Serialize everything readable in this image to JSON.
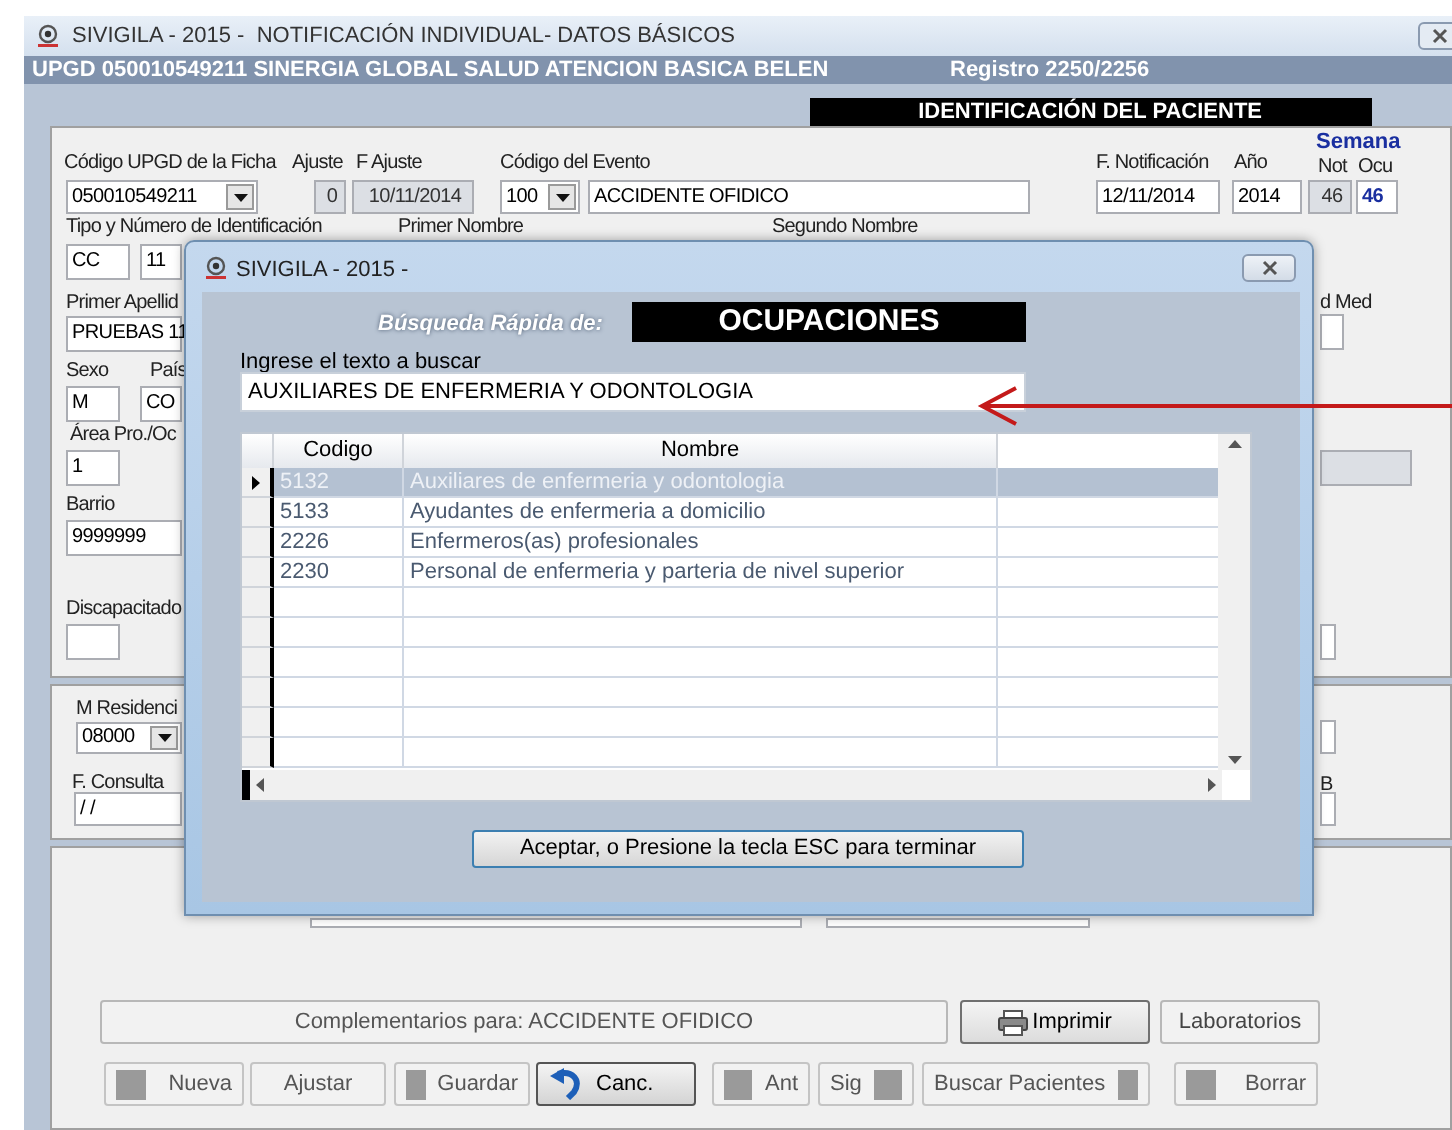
{
  "window": {
    "title": "SIVIGILA - 2015 -  NOTIFICACIÓN INDIVIDUAL- DATOS BÁSICOS"
  },
  "header": {
    "upgd": "UPGD 050010549211 SINERGIA GLOBAL SALUD ATENCION BASICA BELEN",
    "registro": "Registro 2250/2256"
  },
  "section_title": "IDENTIFICACIÓN DEL PACIENTE",
  "labels": [
    {
      "kind": "plain",
      "text": "Código UPGD de la Ficha"
    },
    {
      "kind": "plain",
      "text": "Ajuste"
    },
    {
      "kind": "plain",
      "text": "F Ajuste"
    },
    {
      "kind": "plain",
      "text": "Código del Evento"
    },
    {
      "kind": "plain",
      "text": "F. Notificación"
    },
    {
      "kind": "plain",
      "text": "Año"
    },
    {
      "kind": "heading",
      "text": "Semana"
    },
    {
      "kind": "plain",
      "text": "Not"
    },
    {
      "kind": "plain",
      "text": "Ocu"
    },
    {
      "kind": "plain",
      "text": "Tipo y Número de Identificación"
    },
    {
      "kind": "plain",
      "text": "Primer Nombre"
    },
    {
      "kind": "plain",
      "text": "Segundo Nombre"
    },
    {
      "kind": "plain",
      "text": "Primer Apellid"
    },
    {
      "kind": "plain",
      "text": "d Med"
    },
    {
      "kind": "plain",
      "text": "Sexo"
    },
    {
      "kind": "plain",
      "text": "País"
    },
    {
      "kind": "plain",
      "text": "Área Pro./Oc"
    },
    {
      "kind": "plain",
      "text": "Barrio"
    },
    {
      "kind": "plain",
      "text": "Discapacitado"
    },
    {
      "kind": "plain",
      "text": "M Residenci"
    },
    {
      "kind": "plain",
      "text": "F. Consulta"
    },
    {
      "kind": "plain",
      "text": "B"
    }
  ],
  "fields": [
    {
      "kind": "combo",
      "value": "050010549211"
    },
    {
      "kind": "readonly",
      "value": "0"
    },
    {
      "kind": "readonly",
      "value": "10/11/2014"
    },
    {
      "kind": "combo",
      "value": "100"
    },
    {
      "kind": "text",
      "value": "ACCIDENTE OFIDICO"
    },
    {
      "kind": "text",
      "value": "12/11/2014"
    },
    {
      "kind": "text",
      "value": "2014"
    },
    {
      "kind": "readonly",
      "value": "46"
    },
    {
      "kind": "accent",
      "value": "46"
    },
    {
      "kind": "text",
      "value": "CC"
    },
    {
      "kind": "text",
      "value": "11"
    },
    {
      "kind": "text",
      "value": "PRUEBAS 11"
    },
    {
      "kind": "text"
    },
    {
      "kind": "text",
      "value": "M"
    },
    {
      "kind": "text",
      "value": "CO"
    },
    {
      "kind": "text",
      "value": "1"
    },
    {
      "kind": "readonly"
    },
    {
      "kind": "text",
      "value": "9999999"
    },
    {
      "kind": "text"
    },
    {
      "kind": "text"
    },
    {
      "kind": "combo",
      "value": "08000"
    },
    {
      "kind": "text"
    },
    {
      "kind": "text",
      "value": "/ /"
    },
    {
      "kind": "text"
    },
    {
      "kind": "text"
    },
    {
      "kind": "text"
    }
  ],
  "complementarios": "Complementarios para: ACCIDENTE OFIDICO",
  "side_buttons": [
    {
      "kind": "print",
      "label": "Imprimir"
    },
    {
      "kind": "plain",
      "label": "Laboratorios"
    }
  ],
  "toolbar": [
    {
      "kind": "square_left",
      "label": "Nueva"
    },
    {
      "kind": "plain",
      "label": "Ajustar"
    },
    {
      "kind": "square_left",
      "label": "Guardar"
    },
    {
      "kind": "undo",
      "label": "Canc."
    },
    {
      "kind": "square_left",
      "label": "Ant"
    },
    {
      "kind": "square_right",
      "label": "Sig"
    },
    {
      "kind": "square_right",
      "label": "Buscar Pacientes"
    },
    {
      "kind": "square_left",
      "label": "Borrar"
    }
  ],
  "dialog": {
    "title": "SIVIGILA - 2015 -",
    "search_label": "Búsqueda Rápida de:",
    "search_target": "OCUPACIONES",
    "prompt": "Ingrese el texto a buscar",
    "query": "AUXILIARES DE ENFERMERIA Y ODONTOLOGIA",
    "columns": [
      "Codigo",
      "Nombre"
    ],
    "rows": [
      {
        "codigo": "5132",
        "nombre": "Auxiliares de enfermeria y odontologia",
        "selected": true
      },
      {
        "codigo": "5133",
        "nombre": "Ayudantes de enfermeria a domicilio",
        "selected": false
      },
      {
        "codigo": "2226",
        "nombre": "Enfermeros(as) profesionales",
        "selected": false
      },
      {
        "codigo": "2230",
        "nombre": "Personal de enfermeria y parteria de nivel superior",
        "selected": false
      }
    ],
    "accept_button": "Aceptar, o Presione la tecla ESC para terminar"
  }
}
